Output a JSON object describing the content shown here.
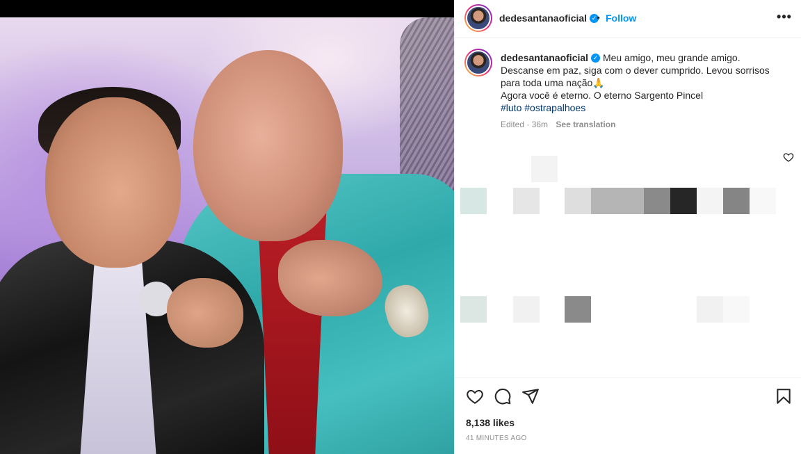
{
  "post": {
    "username": "dedesantanaoficial",
    "follow_label": "Follow",
    "separator": "•",
    "more_glyph": "•••"
  },
  "caption": {
    "username": "dedesantanaoficial",
    "line1": "Meu amigo, meu grande amigo.",
    "line2": "Descanse em paz, siga com o dever cumprido. Levou sorrisos para toda uma nação🙏",
    "line3": "Agora você é eterno. O eterno Sargento Pincel",
    "hashtags": [
      "#luto",
      "#ostrapalhoes"
    ],
    "edited": "Edited · 36m",
    "see_translation": "See translation"
  },
  "engagement": {
    "likes": "8,138 likes",
    "timestamp": "41 MINUTES AGO"
  },
  "icons": {
    "verified": "verified-badge-icon",
    "like": "heart-icon",
    "comment": "comment-icon",
    "share": "send-icon",
    "save": "bookmark-icon",
    "more": "more-options-icon"
  },
  "colors": {
    "link_blue": "#0095f6",
    "hashtag": "#00376b",
    "muted": "#8e8e8e",
    "text": "#262626"
  }
}
